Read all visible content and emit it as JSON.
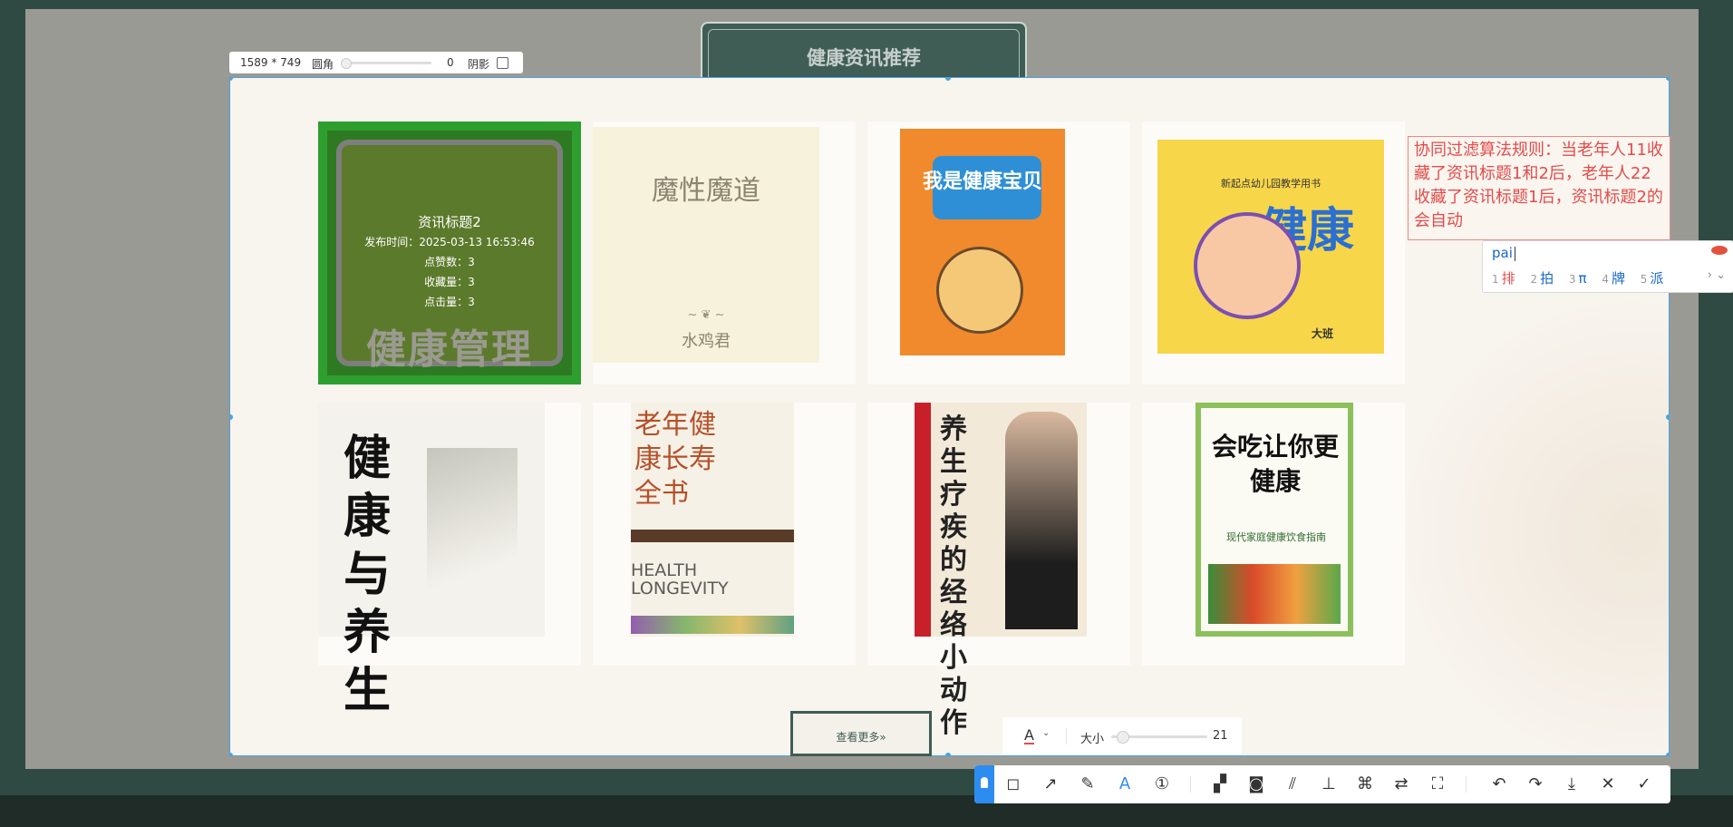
{
  "page": {
    "section_title": "健康资讯推荐",
    "view_more": "查看更多»"
  },
  "capture": {
    "dimensions": "1589 * 749",
    "corner_label": "圆角",
    "corner_value": "0",
    "shadow_label": "阴影"
  },
  "highlighted_card": {
    "title": "资讯标题2",
    "publish_time": "发布时间：2025-03-13 16:53:46",
    "likes": "点赞数：3",
    "favorites": "收藏量：3",
    "clicks": "点击量：3",
    "cover_text": "健康管理"
  },
  "books": [
    {
      "title": "魔性魔道",
      "author": "水鸡君"
    },
    {
      "title": "我是健康宝贝"
    },
    {
      "title": "健康",
      "subtitle": "新起点幼儿园教学用书",
      "badge": "大班"
    },
    {
      "title": "健康与养生"
    },
    {
      "title": "老年健康长寿全书",
      "subtitle": "HEALTH LONGEVITY"
    },
    {
      "title": "养生疗疾的经络小动作"
    },
    {
      "title": "会吃让你更健康",
      "subtitle": "现代家庭健康饮食指南"
    }
  ],
  "annotation": {
    "text": "协同过滤算法规则：当老年人11收藏了资讯标题1和2后，老年人22收藏了资讯标题1后，资讯标题2的会自动"
  },
  "ime": {
    "pinyin": "pai",
    "candidates": [
      {
        "n": "1",
        "c": "排"
      },
      {
        "n": "2",
        "c": "拍"
      },
      {
        "n": "3",
        "c": "π"
      },
      {
        "n": "4",
        "c": "牌"
      },
      {
        "n": "5",
        "c": "派"
      }
    ],
    "nav": "› ⌄"
  },
  "size_bar": {
    "color_glyph": "A",
    "label": "大小",
    "value": "21"
  },
  "toolbar": {
    "tools": [
      {
        "name": "shape-tool-icon",
        "glyph": "◻"
      },
      {
        "name": "arrow-tool-icon",
        "glyph": "↗"
      },
      {
        "name": "pen-tool-icon",
        "glyph": "✎"
      },
      {
        "name": "text-tool-icon",
        "glyph": "A"
      },
      {
        "name": "number-tool-icon",
        "glyph": "①"
      },
      {
        "name": "mosaic-tool-icon",
        "glyph": "▞"
      },
      {
        "name": "blur-tool-icon",
        "glyph": "◙"
      },
      {
        "name": "stripe-tool-icon",
        "glyph": "⫽"
      },
      {
        "name": "pin-tool-icon",
        "glyph": "⊥"
      },
      {
        "name": "ocr-tool-icon",
        "glyph": "⌘"
      },
      {
        "name": "translate-tool-icon",
        "glyph": "⇄"
      },
      {
        "name": "scan-tool-icon",
        "glyph": "⛶"
      },
      {
        "name": "undo-icon",
        "glyph": "↶"
      },
      {
        "name": "redo-icon",
        "glyph": "↷"
      },
      {
        "name": "download-icon",
        "glyph": "⤓"
      },
      {
        "name": "close-icon",
        "glyph": "✕"
      },
      {
        "name": "confirm-icon",
        "glyph": "✓"
      }
    ]
  }
}
